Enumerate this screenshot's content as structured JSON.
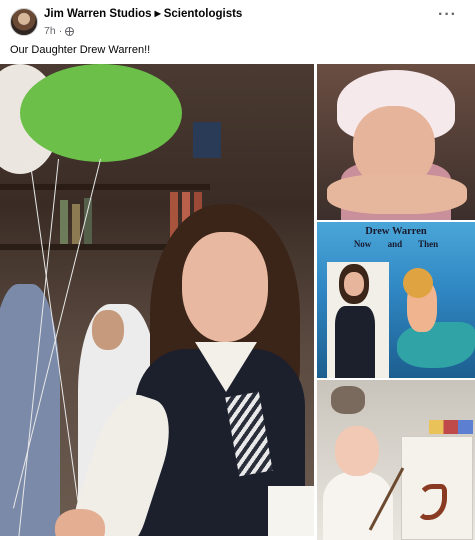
{
  "post": {
    "author": "Jim Warren Studios",
    "group": "Scientologists",
    "time": "7h",
    "audience_icon": "globe-icon",
    "more_icon": "more-options-icon",
    "text": "Our Daughter Drew Warren!!"
  },
  "photos": {
    "overlay_title": "Drew Warren",
    "overlay_now": "Now",
    "overlay_and": "and",
    "overlay_then": "Then"
  },
  "colors": {
    "text_primary": "#050505",
    "text_secondary": "#65676b",
    "balloon_green": "#6cc04a"
  }
}
